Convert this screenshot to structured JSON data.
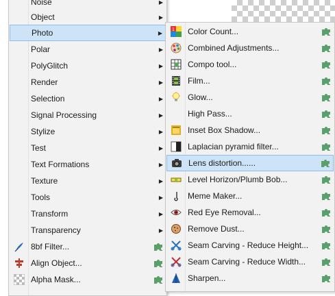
{
  "left_menu": {
    "items": [
      {
        "label": "Noise"
      },
      {
        "label": "Object"
      },
      {
        "label": "Photo"
      },
      {
        "label": "Polar"
      },
      {
        "label": "PolyGlitch"
      },
      {
        "label": "Render"
      },
      {
        "label": "Selection"
      },
      {
        "label": "Signal Processing"
      },
      {
        "label": "Stylize"
      },
      {
        "label": "Test"
      },
      {
        "label": "Text Formations"
      },
      {
        "label": "Texture"
      },
      {
        "label": "Tools"
      },
      {
        "label": "Transform"
      },
      {
        "label": "Transparency"
      },
      {
        "label": "8bf Filter..."
      },
      {
        "label": "Align Object..."
      },
      {
        "label": "Alpha Mask..."
      }
    ],
    "highlighted": "Photo"
  },
  "right_menu": {
    "items": [
      {
        "label": "Color Count...",
        "icon": "color-count-icon"
      },
      {
        "label": "Combined Adjustments...",
        "icon": "palette-icon"
      },
      {
        "label": "Compo tool...",
        "icon": "compo-tool-icon"
      },
      {
        "label": "Film...",
        "icon": "film-strip-icon"
      },
      {
        "label": "Glow...",
        "icon": "light-bulb-icon"
      },
      {
        "label": "High Pass...",
        "icon": ""
      },
      {
        "label": "Inset Box Shadow...",
        "icon": "inset-shadow-icon"
      },
      {
        "label": "Laplacian pyramid filter...",
        "icon": "laplacian-icon"
      },
      {
        "label": "Lens distortion......",
        "icon": "camera-icon"
      },
      {
        "label": "Level Horizon/Plumb Bob...",
        "icon": "level-icon"
      },
      {
        "label": "Meme Maker...",
        "icon": "meme-icon"
      },
      {
        "label": "Red Eye Removal...",
        "icon": "eye-icon"
      },
      {
        "label": "Remove Dust...",
        "icon": "dust-icon"
      },
      {
        "label": "Seam Carving - Reduce Height...",
        "icon": "seam-height-icon"
      },
      {
        "label": "Seam Carving - Reduce Width...",
        "icon": "seam-width-icon"
      },
      {
        "label": "Sharpen...",
        "icon": "sharpen-icon"
      }
    ],
    "highlighted": "Lens distortion......"
  },
  "colors": {
    "highlight": "#cde3f7",
    "highlight_border": "#8fbce6",
    "plugin_green": "#5aa06a"
  }
}
